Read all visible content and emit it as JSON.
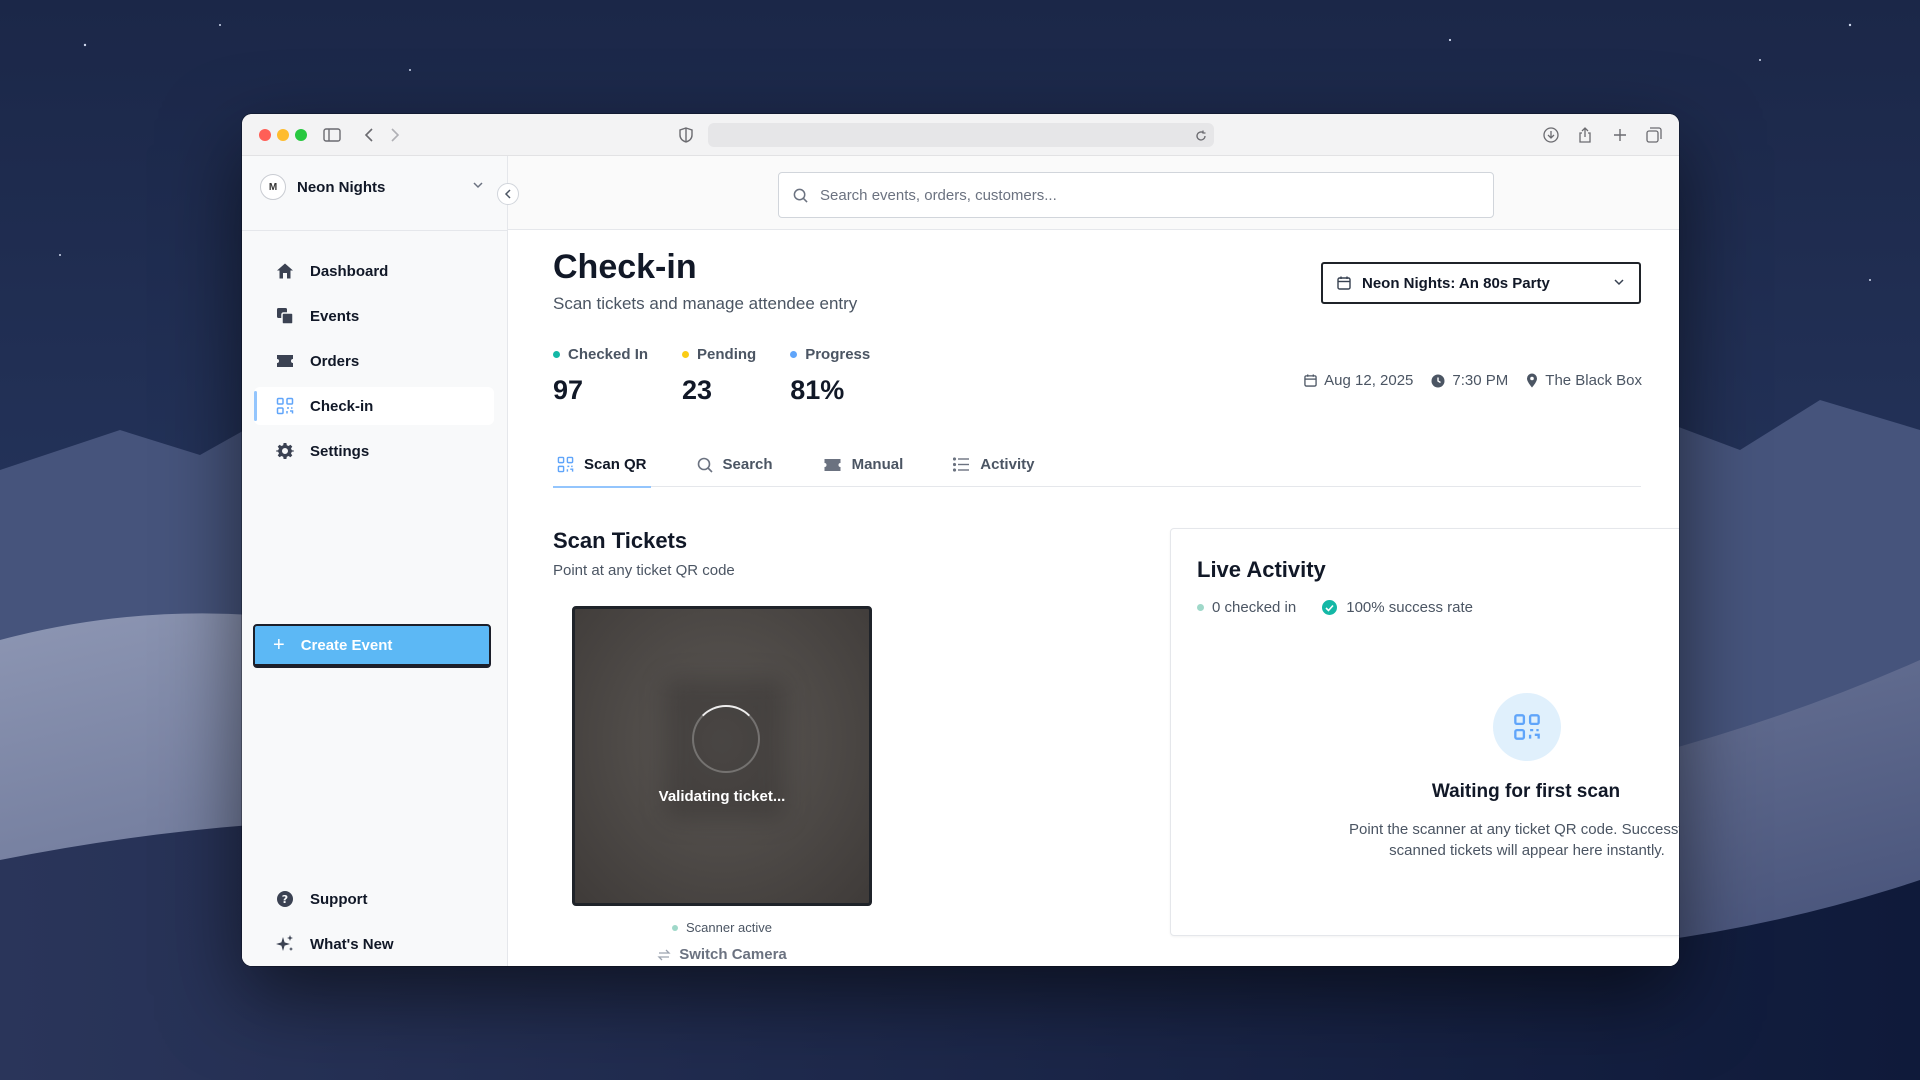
{
  "brand": {
    "accent": "#5cb8f5",
    "dark": "#1f2329",
    "checked_in_dot": "#14b8a6",
    "pending_dot": "#facc15",
    "progress_dot": "#60a5fa"
  },
  "sidebar": {
    "org_initial": "M",
    "org_name": "Neon Nights",
    "items": [
      {
        "label": "Dashboard",
        "icon": "home-icon"
      },
      {
        "label": "Events",
        "icon": "events-icon"
      },
      {
        "label": "Orders",
        "icon": "ticket-icon"
      },
      {
        "label": "Check-in",
        "icon": "qr-code-icon",
        "active": true
      },
      {
        "label": "Settings",
        "icon": "gear-icon"
      }
    ],
    "create_event_label": "Create Event",
    "footer_items": [
      {
        "label": "Support",
        "icon": "help-circle-icon"
      },
      {
        "label": "What's New",
        "icon": "sparkles-icon"
      }
    ]
  },
  "topbar": {
    "search_placeholder": "Search events, orders, customers..."
  },
  "page": {
    "title": "Check-in",
    "subtitle": "Scan tickets and manage attendee entry",
    "event_selector": "Neon Nights: An 80s Party",
    "stats": [
      {
        "label": "Checked In",
        "value": "97"
      },
      {
        "label": "Pending",
        "value": "23"
      },
      {
        "label": "Progress",
        "value": "81%"
      }
    ],
    "meta": {
      "date": "Aug 12, 2025",
      "time": "7:30 PM",
      "venue": "The Black Box"
    },
    "tabs": [
      {
        "label": "Scan QR",
        "icon": "qr-code-icon",
        "active": true
      },
      {
        "label": "Search",
        "icon": "search-icon"
      },
      {
        "label": "Manual",
        "icon": "ticket-icon"
      },
      {
        "label": "Activity",
        "icon": "list-icon"
      }
    ]
  },
  "scanner": {
    "title": "Scan Tickets",
    "subtitle": "Point at any ticket QR code",
    "overlay_text": "Validating ticket...",
    "status": "Scanner active",
    "switch_camera": "Switch Camera"
  },
  "live_activity": {
    "title": "Live Activity",
    "checked_in": "0 checked in",
    "success_rate": "100% success rate",
    "empty_title": "Waiting for first scan",
    "empty_desc": "Point the scanner at any ticket QR code. Successfully scanned tickets will appear here instantly."
  }
}
